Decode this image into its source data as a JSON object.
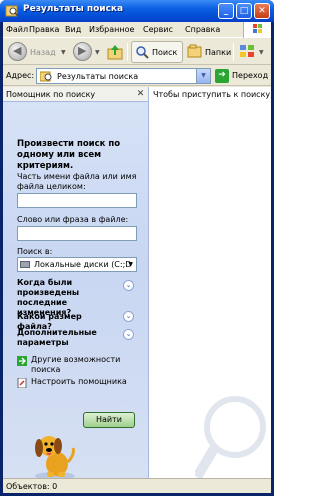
{
  "window": {
    "title": "Результаты поиска"
  },
  "menu": {
    "items": [
      "Файл",
      "Правка",
      "Вид",
      "Избранное",
      "Сервис",
      "Справка"
    ]
  },
  "toolbar": {
    "back_label": "Назад",
    "search_label": "Поиск",
    "folders_label": "Папки"
  },
  "address": {
    "label": "Адрес:",
    "value": "Результаты поиска",
    "go_label": "Переход"
  },
  "search_pane": {
    "title": "Помощник по поиску",
    "prompt": "Произвести поиск по одному или всем критериям.",
    "filename_label": "Часть имени файла или имя файла целиком:",
    "filename_value": "",
    "phrase_label": "Слово или фраза в файле:",
    "phrase_value": "",
    "search_in_label": "Поиск в:",
    "search_in_value": "Локальные диски (C:;D",
    "when_label": "Когда были произведены последние изменения?",
    "size_label": "Какой размер файла?",
    "advanced_label": "Дополнительные параметры",
    "other_link": "Другие возможности поиска",
    "assistant_link": "Настроить помощника",
    "find_button": "Найти"
  },
  "results": {
    "hint": "Чтобы приступить к поиску, сл"
  },
  "status": {
    "text": "Объектов: 0"
  },
  "colors": {
    "titlebar": "#0a5fe3",
    "pane_bg": "#c8d6f2",
    "find_button": "#9fd08c"
  }
}
